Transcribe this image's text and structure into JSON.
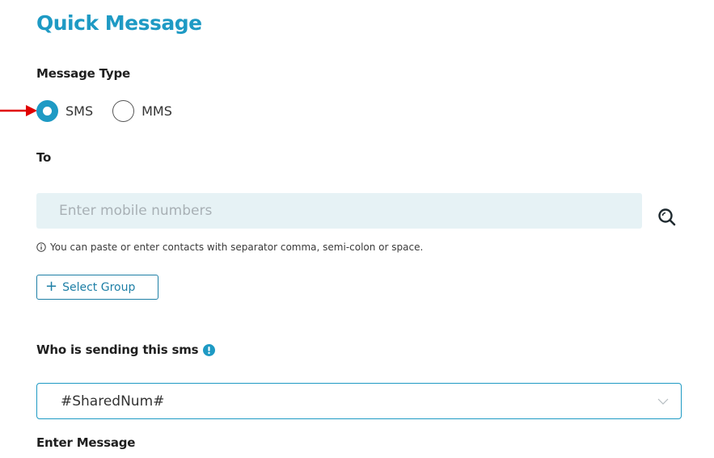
{
  "title": "Quick Message",
  "message_type": {
    "label": "Message Type",
    "options": [
      {
        "label": "SMS",
        "checked": true
      },
      {
        "label": "MMS",
        "checked": false
      }
    ]
  },
  "to": {
    "label": "To",
    "placeholder": "Enter mobile numbers",
    "value": "",
    "hint": "You can paste or enter contacts with separator comma, semi-colon or space."
  },
  "select_group": {
    "plus": "+",
    "label": "Select Group"
  },
  "sender": {
    "label": "Who is sending this sms",
    "value": "#SharedNum#"
  },
  "message": {
    "label": "Enter Message"
  },
  "icons": {
    "search": "search-icon",
    "info": "info-icon",
    "alert": "exclamation-icon",
    "chevron": "chevron-down-icon",
    "arrow": "arrow-right-icon"
  },
  "colors": {
    "accent": "#1e9ac4",
    "button_border": "#1e7fa6",
    "input_bg": "#e6f2f5",
    "annotation_arrow": "#e00000"
  }
}
